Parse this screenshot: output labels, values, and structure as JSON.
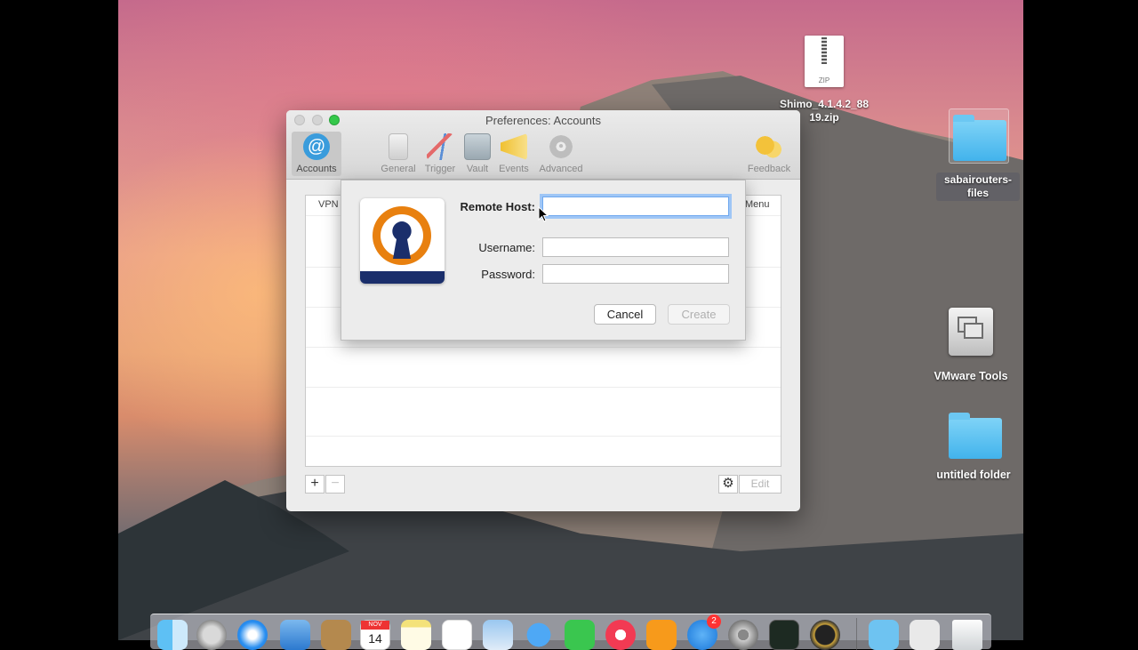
{
  "window": {
    "title": "Preferences: Accounts",
    "toolbar": [
      {
        "label": "Accounts",
        "icon": "at-icon",
        "selected": true
      },
      {
        "label": "General",
        "icon": "switch-icon"
      },
      {
        "label": "Trigger",
        "icon": "trigger-icon"
      },
      {
        "label": "Vault",
        "icon": "vault-icon"
      },
      {
        "label": "Events",
        "icon": "megaphone-icon"
      },
      {
        "label": "Advanced",
        "icon": "gear-icon"
      },
      {
        "label": "Feedback",
        "icon": "speech-bubbles-icon"
      }
    ],
    "table_headers": {
      "left": "VPN",
      "right": "Menu"
    },
    "bottom": {
      "add": "+",
      "remove": "−",
      "edit": "Edit"
    }
  },
  "sheet": {
    "remote_host_label": "Remote Host:",
    "remote_host_value": "",
    "username_label": "Username:",
    "username_value": "",
    "password_label": "Password:",
    "password_value": "",
    "cancel_label": "Cancel",
    "create_label": "Create"
  },
  "desktop": {
    "zip_label": "Shimo_4.1.4.2_8819.zip",
    "zip_badge": "ZIP",
    "folder1_label": "sabairouters-files",
    "vmware_label": "VMware Tools",
    "folder2_label": "untitled folder"
  },
  "dock": {
    "calendar_month": "NOV",
    "calendar_day": "14",
    "appstore_badge": "2"
  },
  "colors": {
    "accent": "#6fa8ee",
    "openvpn_orange": "#e8800f",
    "openvpn_navy": "#1a2e6b",
    "close": "#fc605c",
    "minimize": "#fdbc40",
    "zoom": "#34c84a"
  }
}
